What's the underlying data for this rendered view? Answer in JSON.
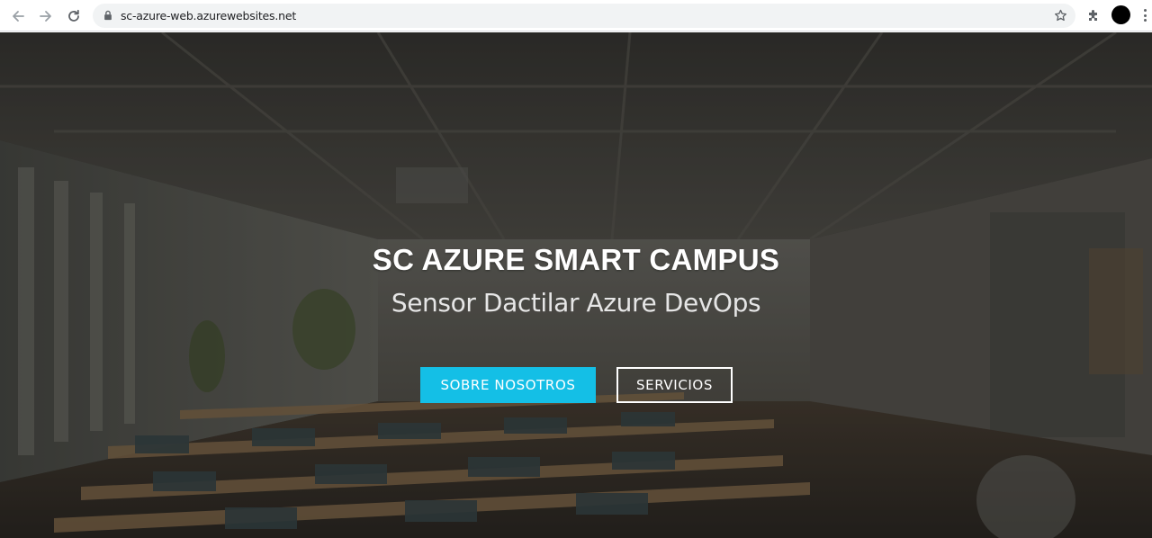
{
  "browser": {
    "url": "sc-azure-web.azurewebsites.net",
    "icons": [
      "back-arrow-icon",
      "forward-arrow-icon",
      "reload-icon",
      "lock-icon",
      "star-icon",
      "puzzle-icon",
      "avatar",
      "more-vert-icon"
    ]
  },
  "hero": {
    "title": "SC AZURE SMART CAMPUS",
    "subtitle": "Sensor Dactilar Azure DevOps",
    "buttons": {
      "primary_label": "SOBRE NOSOTROS",
      "secondary_label": "SERVICIOS"
    }
  },
  "colors": {
    "accent": "#14bfe6",
    "hero_text": "#ffffff"
  }
}
